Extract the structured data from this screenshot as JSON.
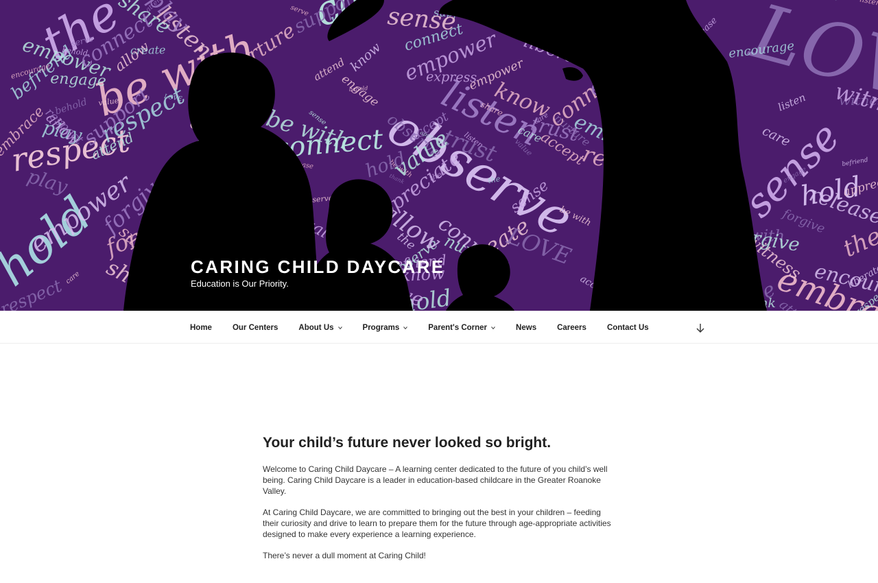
{
  "header": {
    "site_title": "CARING CHILD DAYCARE",
    "tagline": "Education is Our Priority.",
    "hero_words": [
      "the",
      "be with",
      "care",
      "LOVE",
      "observe",
      "listen",
      "respect",
      "hold",
      "connect",
      "share",
      "sense",
      "embrace",
      "trust",
      "allow",
      "play",
      "witness",
      "befriend",
      "nurture",
      "liberate",
      "encourage",
      "engage",
      "express",
      "serve",
      "value",
      "know",
      "forgive",
      "empower",
      "accept",
      "attend",
      "create",
      "support",
      "behold",
      "release",
      "thank",
      "appreciate"
    ],
    "colors": {
      "hero_background": "#4a1a6b",
      "silhouette": "#000000"
    }
  },
  "nav": {
    "items": [
      {
        "label": "Home",
        "has_submenu": false
      },
      {
        "label": "Our Centers",
        "has_submenu": false
      },
      {
        "label": "About Us",
        "has_submenu": true
      },
      {
        "label": "Programs",
        "has_submenu": true
      },
      {
        "label": "Parent's Corner",
        "has_submenu": true
      },
      {
        "label": "News",
        "has_submenu": false
      },
      {
        "label": "Careers",
        "has_submenu": false
      },
      {
        "label": "Contact Us",
        "has_submenu": false
      }
    ],
    "scroll_icon": "arrow-down-icon"
  },
  "main": {
    "heading": "Your child’s future never looked so bright.",
    "paragraphs": [
      "Welcome to Caring Child Daycare – A learning center dedicated to the future of you child’s well being. Caring Child Daycare is a leader in education-based childcare in the Greater Roanoke Valley.",
      "At Caring Child Daycare, we are committed to bringing out the best in your children – feeding their curiosity and drive to learn to prepare them for the future through age-appropriate activities designed to make every experience a learning experience.",
      "There’s never a dull moment at Caring Child!"
    ]
  }
}
